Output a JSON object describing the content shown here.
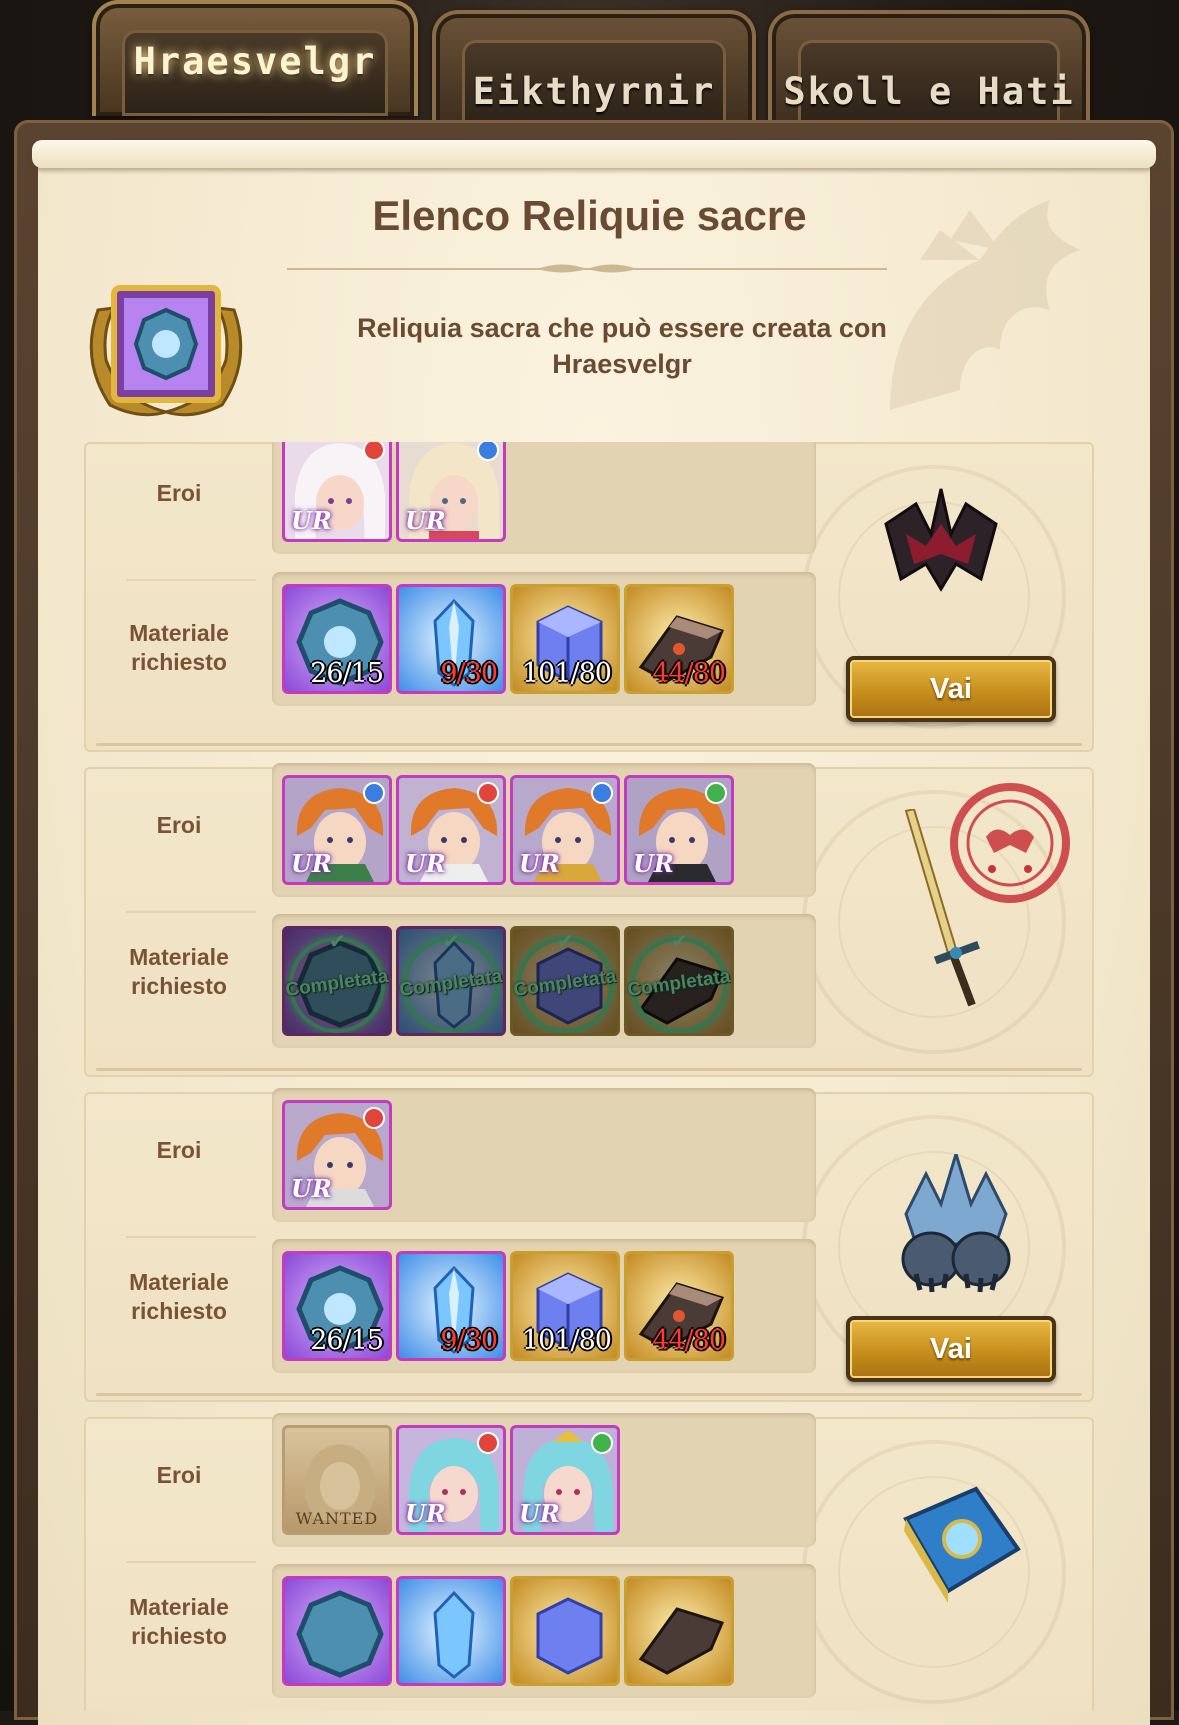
{
  "tabs": [
    {
      "label": "Hraesvelgr",
      "active": true
    },
    {
      "label": "Eikthyrnir",
      "active": false
    },
    {
      "label": "Skoll e Hati",
      "active": false
    }
  ],
  "panel": {
    "title": "Elenco Reliquie sacre",
    "subtitle_line1": "Reliquia sacra che può essere creata con",
    "subtitle_line2": "Hraesvelgr"
  },
  "labels": {
    "heroes": "Eroi",
    "materials_line1": "Materiale",
    "materials_line2": "richiesto",
    "go_button": "Vai",
    "completed": "Completata",
    "hero_rarity": "UR",
    "wanted": "WANTED"
  },
  "colors": {
    "accent_gold": "#c48c1a",
    "count_ok": "#ffffff",
    "count_low": "#ff3b2f",
    "completed_green": "#46e08a",
    "text_brown": "#6b4a33"
  },
  "relics": [
    {
      "relic_icon": "dark-crown-relic-icon",
      "status": "available",
      "heroes": [
        {
          "portrait": "silver-hair-hero",
          "rarity": "UR",
          "attribute": "red"
        },
        {
          "portrait": "blonde-hair-hero",
          "rarity": "UR",
          "attribute": "blue"
        }
      ],
      "materials": [
        {
          "icon": "relic-fragment-icon",
          "count": "26/15",
          "sufficient": true
        },
        {
          "icon": "blue-crystal-icon",
          "count": "9/30",
          "sufficient": false
        },
        {
          "icon": "magic-cube-icon",
          "count": "101/80",
          "sufficient": true
        },
        {
          "icon": "metal-scrap-icon",
          "count": "44/80",
          "sufficient": false
        }
      ]
    },
    {
      "relic_icon": "holy-sword-relic-icon",
      "status": "cleared",
      "heroes": [
        {
          "portrait": "orange-hair-hero-green-cape",
          "rarity": "UR",
          "attribute": "blue"
        },
        {
          "portrait": "orange-hair-hero-white-cape",
          "rarity": "UR",
          "attribute": "red"
        },
        {
          "portrait": "orange-hair-hero-gold-armor",
          "rarity": "UR",
          "attribute": "blue"
        },
        {
          "portrait": "orange-hair-hero-dark-coat",
          "rarity": "UR",
          "attribute": "green"
        }
      ],
      "materials": [
        {
          "icon": "relic-fragment-icon",
          "completed": true
        },
        {
          "icon": "blue-crystal-icon",
          "completed": true
        },
        {
          "icon": "magic-cube-icon",
          "completed": true
        },
        {
          "icon": "metal-scrap-icon",
          "completed": true
        }
      ]
    },
    {
      "relic_icon": "ice-gauntlets-relic-icon",
      "status": "available",
      "heroes": [
        {
          "portrait": "orange-hair-hero-armor",
          "rarity": "UR",
          "attribute": "red"
        }
      ],
      "materials": [
        {
          "icon": "relic-fragment-icon",
          "count": "26/15",
          "sufficient": true
        },
        {
          "icon": "blue-crystal-icon",
          "count": "9/30",
          "sufficient": false
        },
        {
          "icon": "magic-cube-icon",
          "count": "101/80",
          "sufficient": true
        },
        {
          "icon": "metal-scrap-icon",
          "count": "44/80",
          "sufficient": false
        }
      ]
    },
    {
      "relic_icon": "spell-book-relic-icon",
      "status": "locked",
      "heroes": [
        {
          "portrait": "wanted-poster",
          "wanted": true
        },
        {
          "portrait": "teal-hair-hero",
          "rarity": "UR",
          "attribute": "red"
        },
        {
          "portrait": "teal-hair-hero-crown",
          "rarity": "UR",
          "attribute": "green"
        }
      ],
      "materials": []
    }
  ]
}
